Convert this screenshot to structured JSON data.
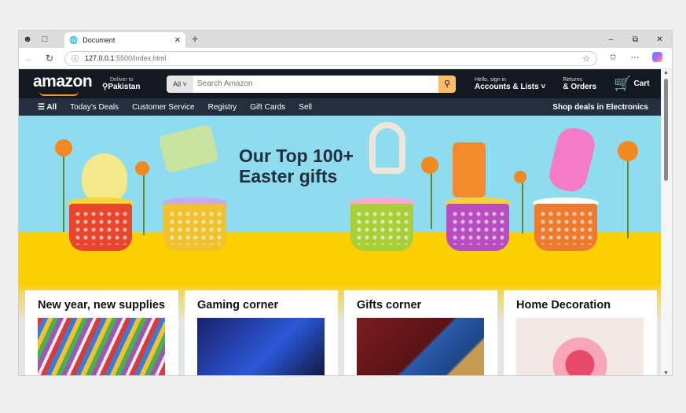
{
  "browser": {
    "tab_title": "Document",
    "url_host": "127.0.0.1",
    "url_path": ":5500/index.html",
    "icons": [
      "profile-icon",
      "tabs-icon",
      "globe-icon",
      "close-icon",
      "plus-icon",
      "minimize-icon",
      "restore-icon",
      "back-icon",
      "refresh-icon",
      "info-icon",
      "favorite-star-icon",
      "favorites-icon",
      "more-icon",
      "copilot-icon"
    ]
  },
  "amazon": {
    "logo": "amazon",
    "deliver_line1": "Deliver to",
    "deliver_line2": "Pakistan",
    "search_category": "All",
    "search_placeholder": "Search Amazon",
    "account_line1": "Hello, sign in",
    "account_line2": "Accounts & Lists",
    "returns_line1": "Returns",
    "returns_line2": "& Orders",
    "cart_label": "Cart",
    "subnav": [
      "All",
      "Today's Deals",
      "Customer Service",
      "Registry",
      "Gift Cards",
      "Sell"
    ],
    "subnav_promo": "Shop deals in Electronics",
    "hero_line1": "Our Top 100+",
    "hero_line2": "Easter gifts",
    "cards": [
      {
        "title": "New year, new supplies"
      },
      {
        "title": "Gaming corner"
      },
      {
        "title": "Gifts corner"
      },
      {
        "title": "Home Decoration"
      }
    ],
    "colors": {
      "nav_dark": "#131921",
      "nav_sub": "#232f3e",
      "search_button": "#febd69",
      "hero_sky": "#8fdcef",
      "hero_floor": "#fcd000"
    }
  }
}
